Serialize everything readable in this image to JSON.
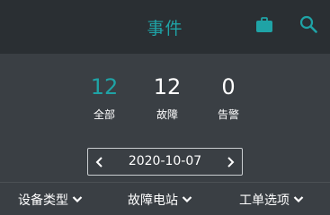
{
  "header": {
    "title": "事件",
    "icons": [
      "briefcase-icon",
      "search-icon"
    ],
    "accent_color": "#1fa3a6"
  },
  "stats": [
    {
      "value": "12",
      "label": "全部",
      "active": true
    },
    {
      "value": "12",
      "label": "故障",
      "active": false
    },
    {
      "value": "0",
      "label": "告警",
      "active": false
    }
  ],
  "date_selector": {
    "date": "2020-10-07",
    "prev_icon": "chevron-left-icon",
    "next_icon": "chevron-right-icon"
  },
  "filters": [
    {
      "label": "设备类型"
    },
    {
      "label": "故障电站"
    },
    {
      "label": "工单选项"
    }
  ]
}
